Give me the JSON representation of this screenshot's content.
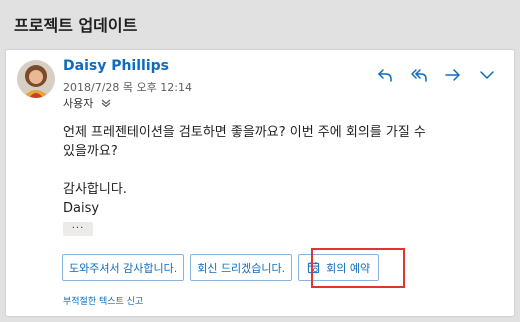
{
  "header": {
    "title": "프로젝트 업데이트"
  },
  "message": {
    "sender": "Daisy Phillips",
    "date": "2018/7/28 목 오후 12:14",
    "to": "사용자",
    "body_lines": [
      "언제 프레젠테이션을 검토하면 좋을까요? 이번 주에 회의를 가질 수",
      "있을까요?"
    ],
    "closing": "감사합니다.",
    "signature": "Daisy",
    "ellipsis": "···"
  },
  "actions": {
    "reply": "reply-icon",
    "reply_all": "reply-all-icon",
    "forward": "forward-icon",
    "more": "chevron-down-icon"
  },
  "suggested_replies": [
    {
      "label": "도와주셔서 감사합니다."
    },
    {
      "label": "회신 드리겠습니다."
    },
    {
      "label": "회의 예약",
      "icon": "calendar-icon"
    }
  ],
  "report_link": "부적절한 텍스트 신고",
  "colors": {
    "accent": "#0f6cbd",
    "highlight": "#e0362e",
    "background": "#e1e1e1"
  }
}
